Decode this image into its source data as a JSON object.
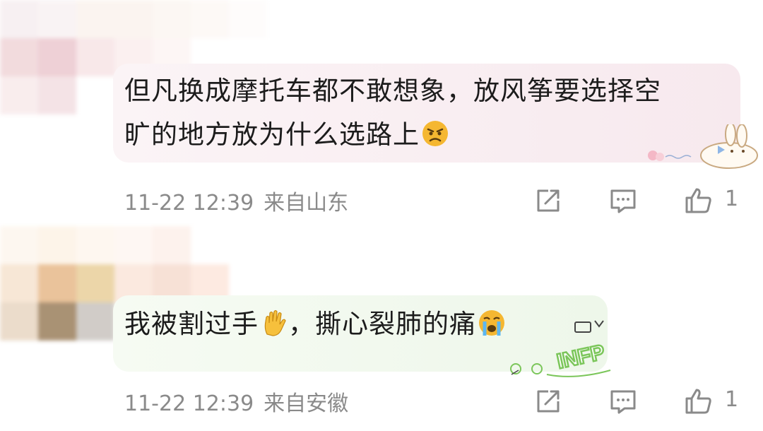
{
  "comments": [
    {
      "text_line1": "但凡换成摩托车都不敢想象，放风筝要选择空",
      "text_line2": "旷的地方放为什么选路上",
      "emoji": "angry-face-icon",
      "time": "11-22 12:39",
      "location": "来自山东",
      "like_count": "1",
      "bubble_color": "#f7e9ee"
    },
    {
      "text_part1": "我被割过手",
      "text_part2": "，撕心裂肺的痛",
      "emoji_1": "raised-hand-icon",
      "emoji_2": "loudly-crying-face-icon",
      "time": "11-22 12:39",
      "location": "来自安徽",
      "like_count": "1",
      "bubble_color": "#eef7ea"
    }
  ],
  "icons": {
    "share": "share-icon",
    "reply": "comment-icon",
    "like": "thumbs-up-icon"
  },
  "colors": {
    "meta_text": "#8a8a8a",
    "body_text": "#1c1c1c",
    "accent_green": "#7bc65a"
  }
}
